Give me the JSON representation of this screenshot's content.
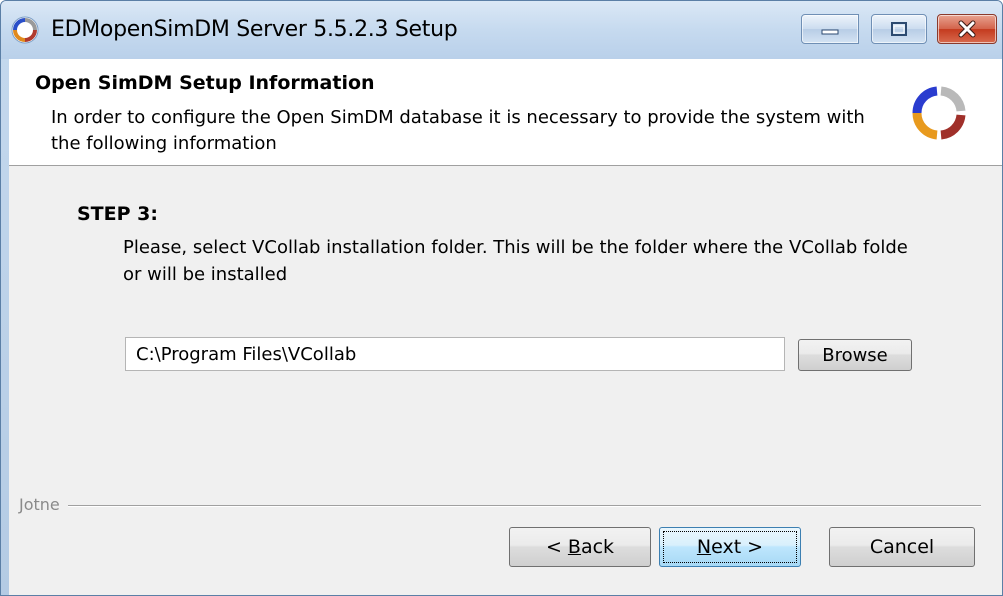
{
  "window": {
    "title": "EDMopenSimDM Server 5.5.2.3 Setup",
    "controls": {
      "minimize": "minimize-icon",
      "maximize": "maximize-icon",
      "close": "close-icon"
    },
    "close_color": "#c43b1f"
  },
  "header": {
    "title": "Open SimDM Setup Information",
    "subtitle": "In order to configure the Open SimDM database it is necessary to provide the system with the following information",
    "logo": "open-simdm-logo"
  },
  "step": {
    "title": "STEP 3:",
    "description": "Please, select VCollab installation folder. This will be the folder where the VCollab folde\nor will be installed"
  },
  "folder": {
    "value": "C:\\Program Files\\VCollab",
    "browse_label": "Browse"
  },
  "footer": {
    "brand": "Jotne",
    "back": {
      "prefix": "< ",
      "mnemonic": "B",
      "rest": "ack"
    },
    "next": {
      "mnemonic": "N",
      "rest": "ext >"
    },
    "cancel": "Cancel"
  },
  "colors": {
    "panel": "#f0f0f0",
    "title_bar": "#c6daef",
    "focus_button": "#bee6fd"
  }
}
